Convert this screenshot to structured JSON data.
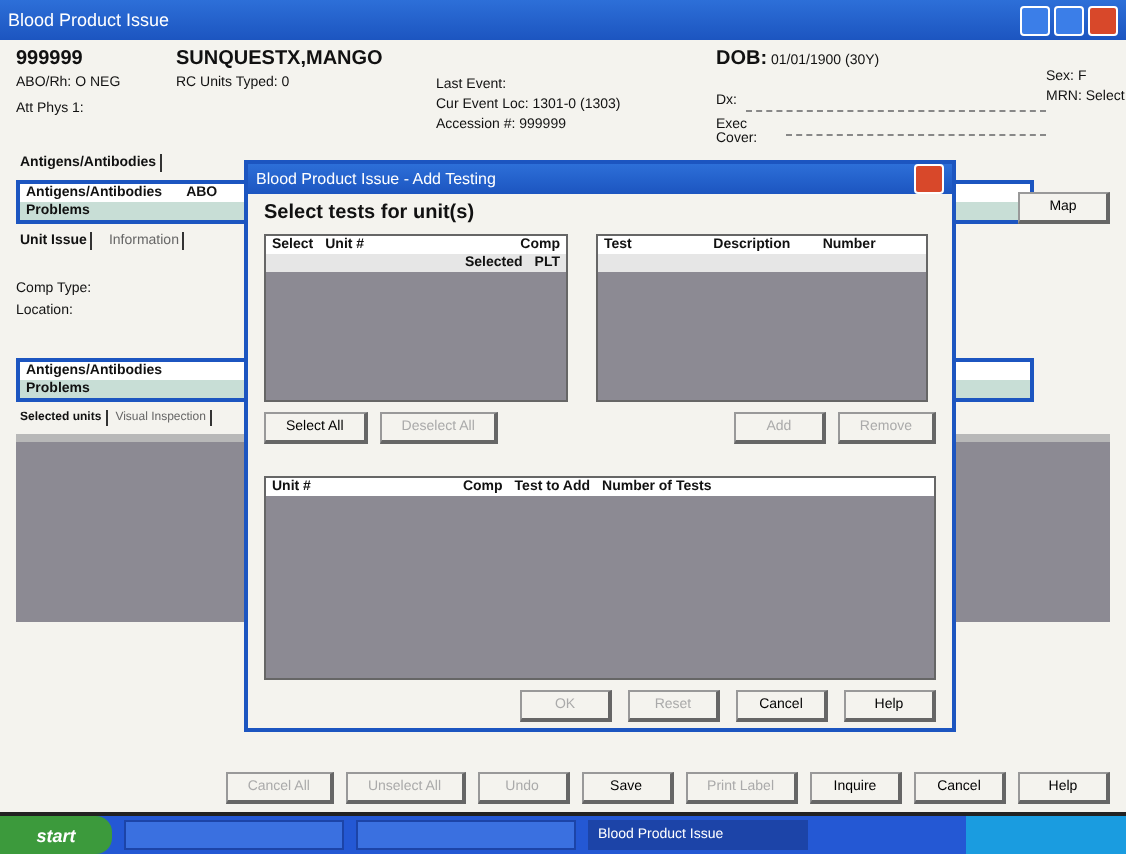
{
  "window": {
    "title": "Blood Product Issue"
  },
  "patient": {
    "id": "999999",
    "name": "SUNQUESTX,MANGO",
    "abo_label": "ABO/Rh:",
    "abo": "O NEG",
    "units_typed": "RC Units Typed: 0",
    "last_event": "Last Event:",
    "cur_event": "Cur Event Loc: 1301-0 (1303)",
    "accession": "Accession #: 999999",
    "dob_label": "DOB:",
    "dob": "01/01/1900 (30Y)",
    "dx": "Dx:",
    "exec_cover": "Exec Cover:",
    "sex": "Sex: F",
    "mrn": "MRN: Select",
    "phys": "Att Phys 1:"
  },
  "top_tabs": [
    {
      "label": "Antigens/Antibodies",
      "selected": true
    }
  ],
  "upper_list": [
    {
      "label": "Antigens/Antibodies",
      "extra": "ABO"
    },
    {
      "label": "Problems"
    }
  ],
  "unit_tabs": [
    {
      "label": "Unit Issue",
      "selected": true
    },
    {
      "label": "Information",
      "selected": false
    }
  ],
  "fields": [
    "Comp Type:",
    "Location:"
  ],
  "lower_list": [
    {
      "label": "Antigens/Antibodies"
    },
    {
      "label": "Problems"
    }
  ],
  "lower_tabs": [
    {
      "label": "Selected units",
      "selected": true
    },
    {
      "label": "Visual Inspection",
      "selected": false
    }
  ],
  "map_button": "Map",
  "dialog": {
    "title": "Blood Product Issue - Add Testing",
    "prompt": "Select tests for unit(s)",
    "units_table": {
      "columns": [
        "Select",
        "Unit #",
        "Comp"
      ],
      "rows": [
        [
          "",
          "Selected",
          "PLT"
        ]
      ]
    },
    "tests_table": {
      "columns": [
        "Test",
        "Description",
        "Number"
      ]
    },
    "mid_buttons": [
      {
        "label": "Select All",
        "disabled": false
      },
      {
        "label": "Deselect All",
        "disabled": true
      },
      {
        "label": "Add",
        "disabled": true
      },
      {
        "label": "Remove",
        "disabled": true
      }
    ],
    "add_table": {
      "columns": [
        "Unit #",
        "Comp",
        "Test to Add",
        "Number of Tests"
      ]
    },
    "buttons": [
      {
        "label": "OK",
        "disabled": true
      },
      {
        "label": "Reset",
        "disabled": true
      },
      {
        "label": "Cancel",
        "disabled": false
      },
      {
        "label": "Help",
        "disabled": false
      }
    ]
  },
  "buttons": [
    {
      "label": "Cancel All",
      "disabled": true
    },
    {
      "label": "Unselect All",
      "disabled": true
    },
    {
      "label": "Undo",
      "disabled": true
    },
    {
      "label": "Save",
      "disabled": false
    },
    {
      "label": "Print Label",
      "disabled": true
    },
    {
      "label": "Inquire",
      "disabled": false
    },
    {
      "label": "Cancel",
      "disabled": false
    },
    {
      "label": "Help",
      "disabled": false
    }
  ],
  "taskbar": {
    "start": "start",
    "tasks": [
      {
        "selected": false
      },
      {
        "selected": false
      },
      {
        "label": "Blood Product Issue",
        "selected": true
      }
    ]
  }
}
